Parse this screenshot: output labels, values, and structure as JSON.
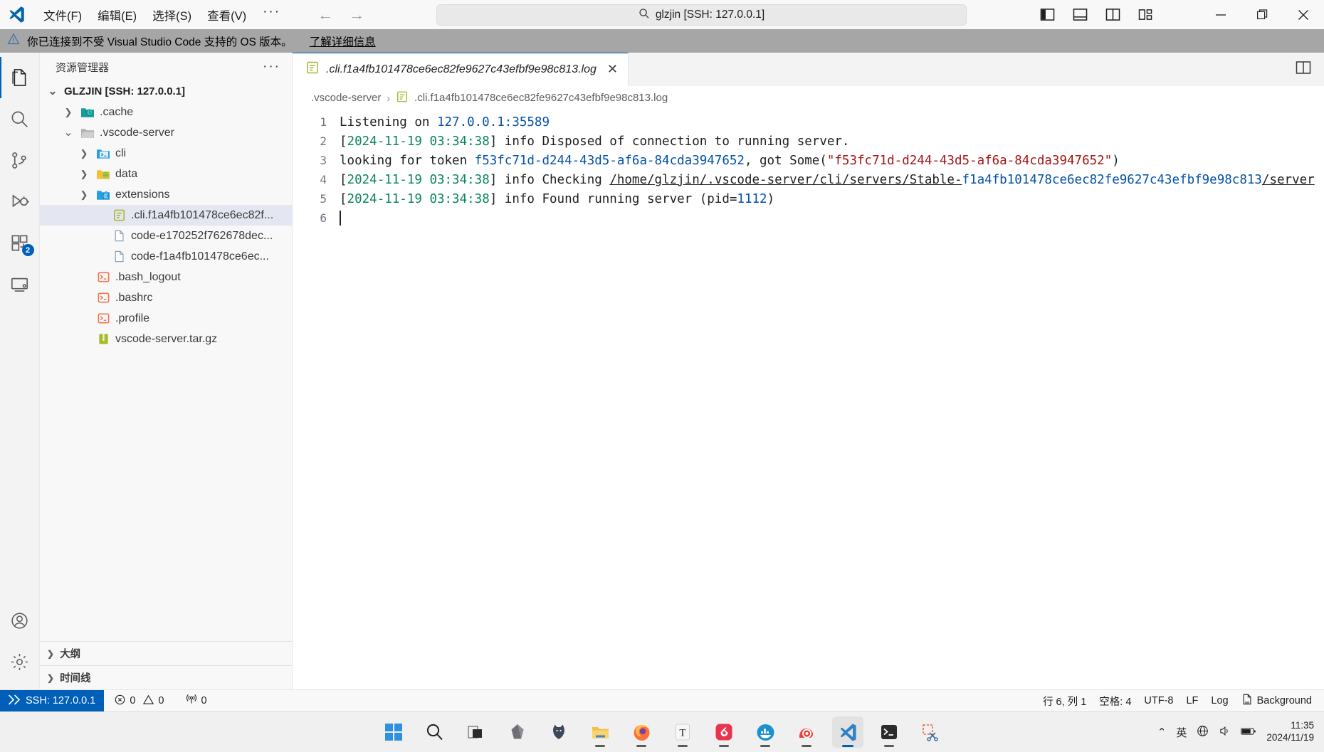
{
  "titlebar": {
    "menus": [
      "文件(F)",
      "编辑(E)",
      "选择(S)",
      "查看(V)"
    ],
    "more": "···",
    "back_icon": "arrow-left-icon",
    "forward_icon": "arrow-right-icon",
    "search_placeholder": "glzjin [SSH: 127.0.0.1]",
    "search_value": "glzjin [SSH: 127.0.0.1]",
    "layout_icons": [
      "toggle-primary-sidebar-icon",
      "toggle-panel-icon",
      "toggle-secondary-sidebar-icon",
      "customize-layout-icon"
    ],
    "minimize": "—",
    "restore": "❐"
  },
  "banner": {
    "icon": "warning-icon",
    "text": "你已连接到不受 Visual Studio Code 支持的 OS 版本。",
    "link": "了解详细信息"
  },
  "activitybar": {
    "items": [
      {
        "name": "explorer",
        "icon": "files-icon",
        "active": true,
        "badge": ""
      },
      {
        "name": "search",
        "icon": "search-icon",
        "active": false,
        "badge": ""
      },
      {
        "name": "source-control",
        "icon": "source-control-icon",
        "active": false,
        "badge": ""
      },
      {
        "name": "run-and-debug",
        "icon": "debug-icon",
        "active": false,
        "badge": ""
      },
      {
        "name": "extensions",
        "icon": "extensions-icon",
        "active": false,
        "badge": "2"
      },
      {
        "name": "remote-explorer",
        "icon": "remote-explorer-icon",
        "active": false,
        "badge": ""
      }
    ],
    "bottom": [
      {
        "name": "accounts",
        "icon": "account-icon"
      },
      {
        "name": "manage",
        "icon": "gear-icon"
      }
    ]
  },
  "sidebar": {
    "title": "资源管理器",
    "more": "···",
    "tree": [
      {
        "label": "GLZJIN [SSH: 127.0.0.1]",
        "depth": 0,
        "type": "root",
        "expanded": true,
        "icon": "chevron-down-icon",
        "selected": false
      },
      {
        "label": ".cache",
        "depth": 1,
        "type": "folder",
        "expanded": false,
        "icon": "folder-cache-icon",
        "selected": false
      },
      {
        "label": ".vscode-server",
        "depth": 1,
        "type": "folder",
        "expanded": true,
        "icon": "folder-open-icon",
        "selected": false
      },
      {
        "label": "cli",
        "depth": 2,
        "type": "folder",
        "expanded": false,
        "icon": "folder-cli-icon",
        "selected": false
      },
      {
        "label": "data",
        "depth": 2,
        "type": "folder",
        "expanded": false,
        "icon": "folder-data-icon",
        "selected": false
      },
      {
        "label": "extensions",
        "depth": 2,
        "type": "folder",
        "expanded": false,
        "icon": "folder-extensions-icon",
        "selected": false
      },
      {
        "label": ".cli.f1a4fb101478ce6ec82f...",
        "depth": 3,
        "type": "file",
        "expanded": false,
        "icon": "log-file-icon",
        "selected": true
      },
      {
        "label": "code-e170252f762678dec...",
        "depth": 3,
        "type": "file",
        "expanded": false,
        "icon": "file-icon",
        "selected": false
      },
      {
        "label": "code-f1a4fb101478ce6ec...",
        "depth": 3,
        "type": "file",
        "expanded": false,
        "icon": "file-icon",
        "selected": false
      },
      {
        "label": ".bash_logout",
        "depth": 2,
        "type": "file",
        "expanded": false,
        "icon": "shell-file-icon",
        "selected": false
      },
      {
        "label": ".bashrc",
        "depth": 2,
        "type": "file",
        "expanded": false,
        "icon": "shell-file-icon",
        "selected": false
      },
      {
        "label": ".profile",
        "depth": 2,
        "type": "file",
        "expanded": false,
        "icon": "shell-file-icon",
        "selected": false
      },
      {
        "label": "vscode-server.tar.gz",
        "depth": 2,
        "type": "file",
        "expanded": false,
        "icon": "archive-file-icon",
        "selected": false
      }
    ],
    "sections": [
      {
        "label": "大纲",
        "icon": "chevron-right-icon"
      },
      {
        "label": "时间线",
        "icon": "chevron-right-icon"
      }
    ]
  },
  "editor": {
    "tab": {
      "icon": "log-file-icon",
      "label": ".cli.f1a4fb101478ce6ec82fe9627c43efbf9e98c813.log",
      "close": "✕"
    },
    "split_icon": "split-editor-icon",
    "breadcrumb": {
      "folder": ".vscode-server",
      "separator": "›",
      "file_icon": "log-file-icon",
      "file": ".cli.f1a4fb101478ce6ec82fe9627c43efbf9e98c813.log"
    },
    "lines": [
      {
        "number": "1",
        "segments": [
          {
            "text": "Listening on ",
            "style": "plain"
          },
          {
            "text": "127.0.0.1:35589",
            "style": "blue"
          }
        ]
      },
      {
        "number": "2",
        "segments": [
          {
            "text": "[",
            "style": "plain"
          },
          {
            "text": "2024-11-19 03:34:38",
            "style": "green"
          },
          {
            "text": "] info Disposed of connection to running server.",
            "style": "plain"
          }
        ]
      },
      {
        "number": "3",
        "segments": [
          {
            "text": "looking for token ",
            "style": "plain"
          },
          {
            "text": "f53fc71d-d244-43d5-af6a-84cda3947652",
            "style": "blue"
          },
          {
            "text": ", got Some(",
            "style": "plain"
          },
          {
            "text": "\"f53fc71d-d244-43d5-af6a-84cda3947652\"",
            "style": "darkred"
          },
          {
            "text": ")",
            "style": "plain"
          }
        ]
      },
      {
        "number": "4",
        "segments": [
          {
            "text": "[",
            "style": "plain"
          },
          {
            "text": "2024-11-19 03:34:38",
            "style": "green"
          },
          {
            "text": "] info Checking ",
            "style": "plain"
          },
          {
            "text": "/home/glzjin/.vscode-server/cli/servers/Stable-",
            "style": "link"
          },
          {
            "text": "f1a4fb101478ce6ec82fe9627c43efbf9e98c813",
            "style": "blue"
          },
          {
            "text": "/server",
            "style": "link"
          }
        ]
      },
      {
        "number": "5",
        "segments": [
          {
            "text": "[",
            "style": "plain"
          },
          {
            "text": "2024-11-19 03:34:38",
            "style": "green"
          },
          {
            "text": "] info Found running server (pid=",
            "style": "plain"
          },
          {
            "text": "1112",
            "style": "blue"
          },
          {
            "text": ")",
            "style": "plain"
          }
        ]
      },
      {
        "number": "6",
        "segments": []
      }
    ]
  },
  "statusbar": {
    "remote_icon": "remote-ssh-icon",
    "remote_label": "SSH: 127.0.0.1",
    "errors_icon": "error-icon",
    "errors": "0",
    "warnings_icon": "warning-triangle-icon",
    "warnings": "0",
    "ports_icon": "radio-tower-icon",
    "ports": "0",
    "cursor_position": "行 6, 列 1",
    "indentation": "空格: 4",
    "encoding": "UTF-8",
    "eol": "LF",
    "language": "Log",
    "notify_icon": "background-tasks-icon",
    "notify_label": "Background"
  },
  "taskbar": {
    "apps": [
      {
        "name": "start-button",
        "icon": "windows-logo-icon",
        "running": false,
        "active": false
      },
      {
        "name": "search-taskbar",
        "icon": "search-icon",
        "running": false,
        "active": false
      },
      {
        "name": "task-view",
        "icon": "task-view-icon",
        "running": false,
        "active": false
      },
      {
        "name": "obsidian",
        "icon": "obsidian-icon",
        "running": false,
        "active": false
      },
      {
        "name": "bitwarden",
        "icon": "cat-icon",
        "running": false,
        "active": false
      },
      {
        "name": "file-explorer",
        "icon": "folder-icon",
        "running": true,
        "active": false
      },
      {
        "name": "firefox",
        "icon": "firefox-icon",
        "running": true,
        "active": false
      },
      {
        "name": "typora",
        "icon": "typora-icon",
        "running": true,
        "active": false
      },
      {
        "name": "netease-music",
        "icon": "netease-music-icon",
        "running": true,
        "active": false
      },
      {
        "name": "docker",
        "icon": "docker-icon",
        "running": true,
        "active": false
      },
      {
        "name": "snail-browser",
        "icon": "snail-icon",
        "running": true,
        "active": false
      },
      {
        "name": "vscode",
        "icon": "vscode-icon",
        "running": true,
        "active": true
      },
      {
        "name": "terminal",
        "icon": "terminal-icon",
        "running": true,
        "active": false
      },
      {
        "name": "snipping-tool",
        "icon": "snipping-tool-icon",
        "running": false,
        "active": false
      }
    ],
    "tray": {
      "expand_icon": "chevron-up-icon",
      "ime": "英",
      "network_icon": "globe-icon",
      "volume_icon": "volume-icon",
      "battery_icon": "battery-icon",
      "time": "11:35",
      "date": "2024/11/19"
    }
  }
}
